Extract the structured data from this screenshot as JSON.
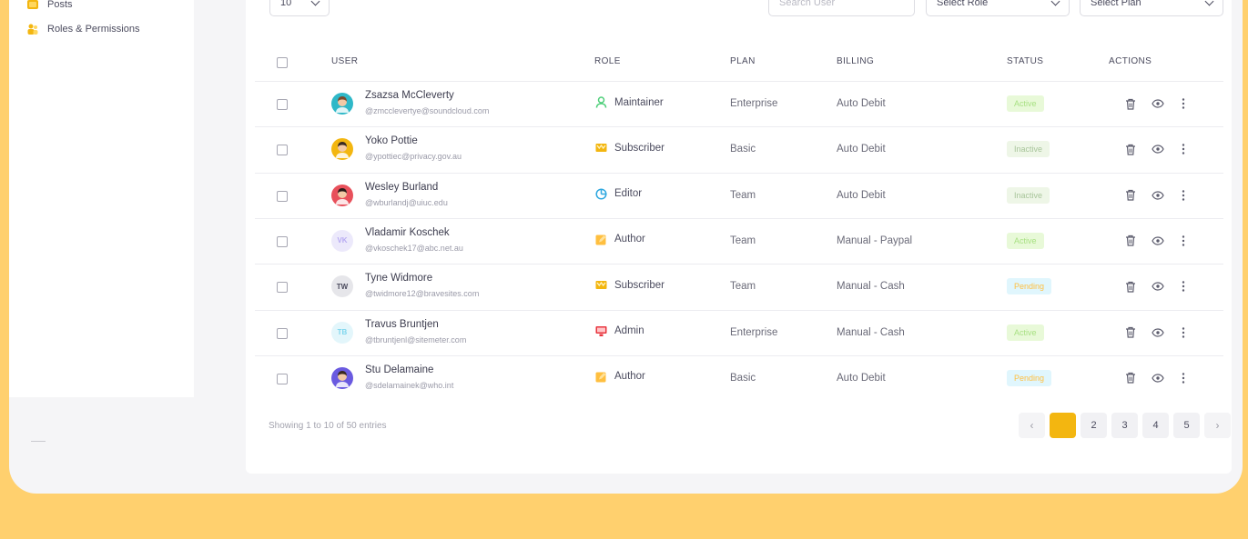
{
  "sidebar": {
    "items": [
      {
        "label": "Posts",
        "icon": "posts-icon"
      },
      {
        "label": "Roles & Permissions",
        "icon": "roles-icon"
      }
    ]
  },
  "filters": {
    "page_size": "10",
    "search_placeholder": "Search User",
    "role_select": "Select Role",
    "plan_select": "Select Plan"
  },
  "table": {
    "headers": {
      "user": "USER",
      "role": "ROLE",
      "plan": "PLAN",
      "billing": "BILLING",
      "status": "STATUS",
      "actions": "ACTIONS"
    },
    "rows": [
      {
        "name": "Zsazsa McCleverty",
        "email": "@zmcclevertye@soundcloud.com",
        "avatar": "",
        "avatar_color": "#2fb8c8",
        "role": "Maintainer",
        "role_icon": "user-icon",
        "plan": "Enterprise",
        "billing": "Auto Debit",
        "status": "Active"
      },
      {
        "name": "Yoko Pottie",
        "email": "@ypottiec@privacy.gov.au",
        "avatar": "",
        "avatar_color": "#f3b610",
        "role": "Subscriber",
        "role_icon": "crown-icon",
        "plan": "Basic",
        "billing": "Auto Debit",
        "status": "Inactive"
      },
      {
        "name": "Wesley Burland",
        "email": "@wburlandj@uiuc.edu",
        "avatar": "",
        "avatar_color": "#e8505b",
        "role": "Editor",
        "role_icon": "chart-pie-icon",
        "plan": "Team",
        "billing": "Auto Debit",
        "status": "Inactive"
      },
      {
        "name": "Vladamir Koschek",
        "email": "@vkoschek17@abc.net.au",
        "avatar": "VK",
        "avatar_color": "#ece9fb",
        "role": "Author",
        "role_icon": "edit-icon",
        "plan": "Team",
        "billing": "Manual - Paypal",
        "status": "Active"
      },
      {
        "name": "Tyne Widmore",
        "email": "@twidmore12@bravesites.com",
        "avatar": "TW",
        "avatar_color": "#e6e6ea",
        "role": "Subscriber",
        "role_icon": "crown-icon",
        "plan": "Team",
        "billing": "Manual - Cash",
        "status": "Pending"
      },
      {
        "name": "Travus Bruntjen",
        "email": "@tbruntjenl@sitemeter.com",
        "avatar": "TB",
        "avatar_color": "#e3f6fb",
        "role": "Admin",
        "role_icon": "desktop-icon",
        "plan": "Enterprise",
        "billing": "Manual - Cash",
        "status": "Active"
      },
      {
        "name": "Stu Delamaine",
        "email": "@sdelamainek@who.int",
        "avatar": "",
        "avatar_color": "#6a5ae0",
        "role": "Author",
        "role_icon": "edit-icon",
        "plan": "Basic",
        "billing": "Auto Debit",
        "status": "Pending"
      }
    ]
  },
  "footer": {
    "entries_text": "Showing 1 to 10 of 50 entries",
    "pages": [
      "1",
      "2",
      "3",
      "4",
      "5"
    ],
    "prev": "‹",
    "next": "›"
  },
  "colors": {
    "background": "#ffd06e",
    "accent": "#f3b610",
    "active": "#a9e184",
    "pending": "#ffbf3f"
  }
}
